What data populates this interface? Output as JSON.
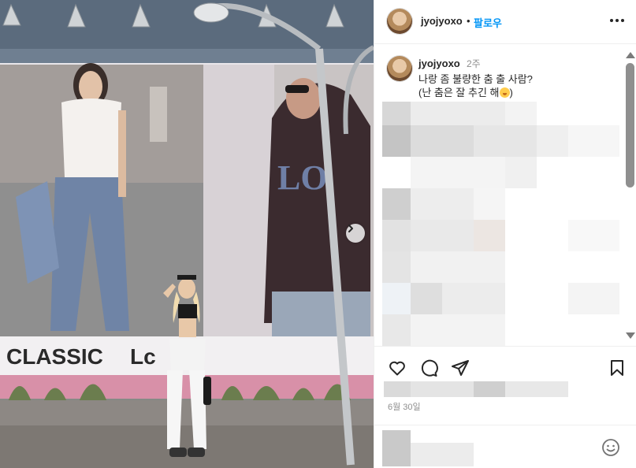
{
  "post": {
    "username": "jyojyoxo",
    "follow_label": "팔로우",
    "separator": "•",
    "caption_time": "2주",
    "caption_line1": "나랑 좀 불량한 춤 출 사람?",
    "caption_line2": "(난 춤은 잘 추긴 해",
    "caption_line2_end": ")",
    "date": "6월 30일"
  },
  "photo": {
    "billboard_text_left": "CLASSIC",
    "billboard_text_right": "Lc"
  },
  "icons": {
    "more": "more-horizontal-icon",
    "next": "chevron-right-icon",
    "like": "heart-icon",
    "comment": "comment-icon",
    "share": "paper-plane-icon",
    "save": "bookmark-icon",
    "emoji": "smiley-icon"
  },
  "colors": {
    "accent": "#0095f6",
    "text": "#262626",
    "muted": "#8e8e8e"
  },
  "comment_input": {
    "placeholder": ""
  }
}
